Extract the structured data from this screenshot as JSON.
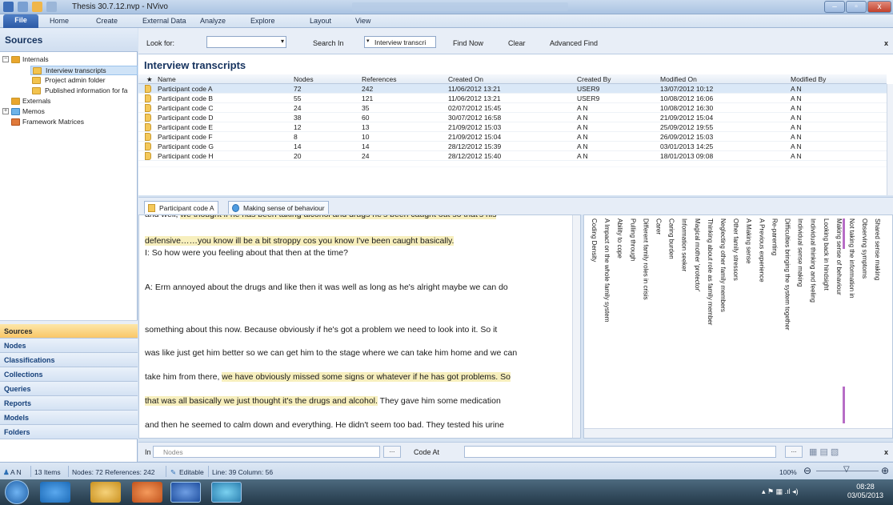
{
  "window": {
    "title": "Thesis 30.7.12.nvp - NVivo",
    "controls": [
      "minimize",
      "maximize",
      "close"
    ]
  },
  "ribbon": {
    "tabs": [
      "File",
      "Home",
      "Create",
      "External Data",
      "Analyze",
      "Explore",
      "Layout",
      "View"
    ]
  },
  "navigation": {
    "header": "Sources",
    "tree": [
      {
        "label": "Internals",
        "level": 0,
        "expanded": true
      },
      {
        "label": "Interview transcripts",
        "level": 1,
        "selected": true
      },
      {
        "label": "Project admin folder",
        "level": 1
      },
      {
        "label": "Published information for fa",
        "level": 1
      },
      {
        "label": "Externals",
        "level": 0
      },
      {
        "label": "Memos",
        "level": 0,
        "expandable": true
      },
      {
        "label": "Framework Matrices",
        "level": 0
      }
    ],
    "buttons": [
      "Sources",
      "Nodes",
      "Classifications",
      "Collections",
      "Queries",
      "Reports",
      "Models",
      "Folders"
    ],
    "active_button": "Sources"
  },
  "findbar": {
    "look_for_label": "Look for:",
    "look_for_value": "",
    "search_in_label": "Search In",
    "search_in_value": "Interview transcri",
    "find_now": "Find Now",
    "clear": "Clear",
    "advanced_find": "Advanced Find",
    "close": "x"
  },
  "list": {
    "title": "Interview transcripts",
    "columns": [
      "Name",
      "Nodes",
      "References",
      "Created On",
      "Created By",
      "Modified On",
      "Modified By"
    ],
    "rows": [
      [
        "Participant code A",
        "72",
        "242",
        "11/06/2012 13:21",
        "USER9",
        "13/07/2012 10:12",
        "A N"
      ],
      [
        "Participant code B",
        "55",
        "121",
        "11/06/2012 13:21",
        "USER9",
        "10/08/2012 16:06",
        "A N"
      ],
      [
        "Participant code C",
        "24",
        "35",
        "02/07/2012 15:45",
        "A N",
        "10/08/2012 16:30",
        "A N"
      ],
      [
        "Participant code D",
        "38",
        "60",
        "30/07/2012 16:58",
        "A N",
        "21/09/2012 15:04",
        "A N"
      ],
      [
        "Participant code E",
        "12",
        "13",
        "21/09/2012 15:03",
        "A N",
        "25/09/2012 19:55",
        "A N"
      ],
      [
        "Participant code F",
        "8",
        "10",
        "21/09/2012 15:04",
        "A N",
        "26/09/2012 15:03",
        "A N"
      ],
      [
        "Participant code G",
        "14",
        "14",
        "28/12/2012 15:39",
        "A N",
        "03/01/2013 14:25",
        "A N"
      ],
      [
        "Participant code H",
        "20",
        "24",
        "28/12/2012 15:40",
        "A N",
        "18/01/2013 09:08",
        "A N"
      ]
    ],
    "selected_row": 0
  },
  "detail_tabs": [
    {
      "label": "Participant code A",
      "active": true,
      "icon": "document-icon"
    },
    {
      "label": "Making sense of behaviour",
      "active": false,
      "icon": "node-icon"
    }
  ],
  "transcript": {
    "lines": [
      {
        "text": "and well, we thought if he has been taking alcohol and drugs he's been caught out so that's his",
        "highlight_from": 10
      },
      {
        "text": "defensive……you know ill be a bit stroppy cos you know I've been caught basically.",
        "highlight_from": 0
      },
      {
        "text": "",
        "highlight_from": -1
      },
      {
        "text": "I: So how were you feeling about that then at the time?",
        "highlight_from": -1
      },
      {
        "text": "",
        "highlight_from": -1
      },
      {
        "text": "A: Erm annoyed about the drugs and like then it was well as long as he's alright maybe we can do",
        "highlight_from": -1
      },
      {
        "text": "",
        "highlight_from": -1
      },
      {
        "text": "something about this now.  Because obviously if he's got a problem we need to look into it.  So it",
        "highlight_from": -1
      },
      {
        "text": "",
        "highlight_from": -1
      },
      {
        "text": "was like just get him better so we can get him to the stage where we can take him home and we can",
        "highlight_from": -1
      },
      {
        "text": "",
        "highlight_from": -1
      },
      {
        "text": "take him from there, ",
        "highlight_from": -1,
        "highlight_text": "we have obviously missed some signs or whatever if he has got problems.  So"
      },
      {
        "text": "",
        "highlight_from": -1
      },
      {
        "text": "",
        "highlight_from": -1,
        "highlight_text": "that was all basically we just thought it's the drugs and alcohol.",
        "after": "  They gave him some medication"
      },
      {
        "text": "",
        "highlight_from": -1
      },
      {
        "text": "and then he seemed to calm down and everything.  He didn't seem too bad.  They tested his urine",
        "highlight_from": -1
      }
    ]
  },
  "coding_stripes": {
    "labels": [
      "Coding Density",
      "A Impact on the whole family system",
      "Ability to cope",
      "Pulling through",
      "Different family roles in crisis",
      "Carer",
      "Caring burden",
      "Information seeker",
      "Magical mother 'protector'",
      "Thinking about role as family member",
      "Neglecting other family members",
      "Other family stressors",
      "A Making sense",
      "A Previous experience",
      "Re-parenting",
      "Difficulties bringing the system together",
      "Individual sense making",
      "Individual thinking and feeling",
      "Looking back in hindsight",
      "Making sense of behaviour",
      "Not taking the information in",
      "Observing symptoms",
      "Shared sense making"
    ],
    "stripe_color": "#b76dc6"
  },
  "codebar": {
    "in_label": "In",
    "nodes_placeholder": "Nodes",
    "code_at_label": "Code At",
    "more": "...",
    "close": "x"
  },
  "status": {
    "user": "A N",
    "items": "13 Items",
    "nodes_refs": "Nodes: 72  References: 242",
    "mode": "Editable",
    "position": "Line: 39  Column: 56",
    "zoom": "100%"
  },
  "taskbar": {
    "time": "08:28",
    "date": "03/05/2013"
  }
}
